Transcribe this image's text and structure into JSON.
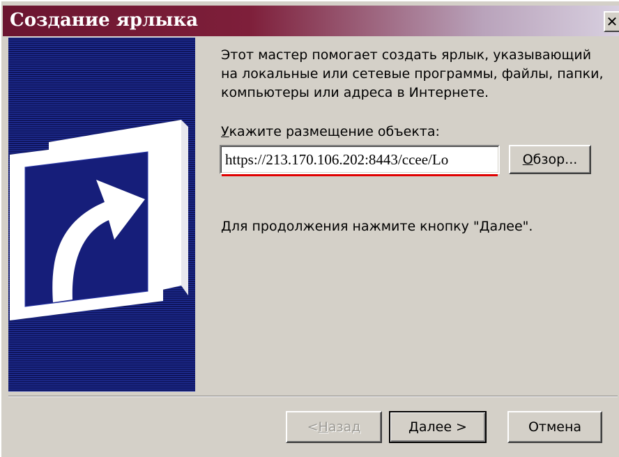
{
  "window": {
    "title": "Создание ярлыка",
    "close_glyph": "✕",
    "titlebar_colors": [
      "#6b1530",
      "#d8d0e0"
    ]
  },
  "banner": {
    "icon": "shortcut-arrow-icon",
    "background_color": "#141c78"
  },
  "intro": {
    "text": "Этот мастер помогает создать ярлык, указывающий на локальные или сетевые программы, файлы, папки, компьютеры или адреса в Интернете."
  },
  "location": {
    "label_accel": "У",
    "label_rest": "кажите размещение объекта:",
    "value": "https://213.170.106.202:8443/ccee/Lo"
  },
  "browse_button": {
    "accel": "О",
    "rest": "бзор..."
  },
  "continue_text": "Для продолжения нажмите кнопку \"Далее\".",
  "nav": {
    "back_prefix": "< ",
    "back_accel": "Н",
    "back_rest": "азад",
    "next_accel": "Д",
    "next_rest": "алее >",
    "cancel": "Отмена"
  }
}
